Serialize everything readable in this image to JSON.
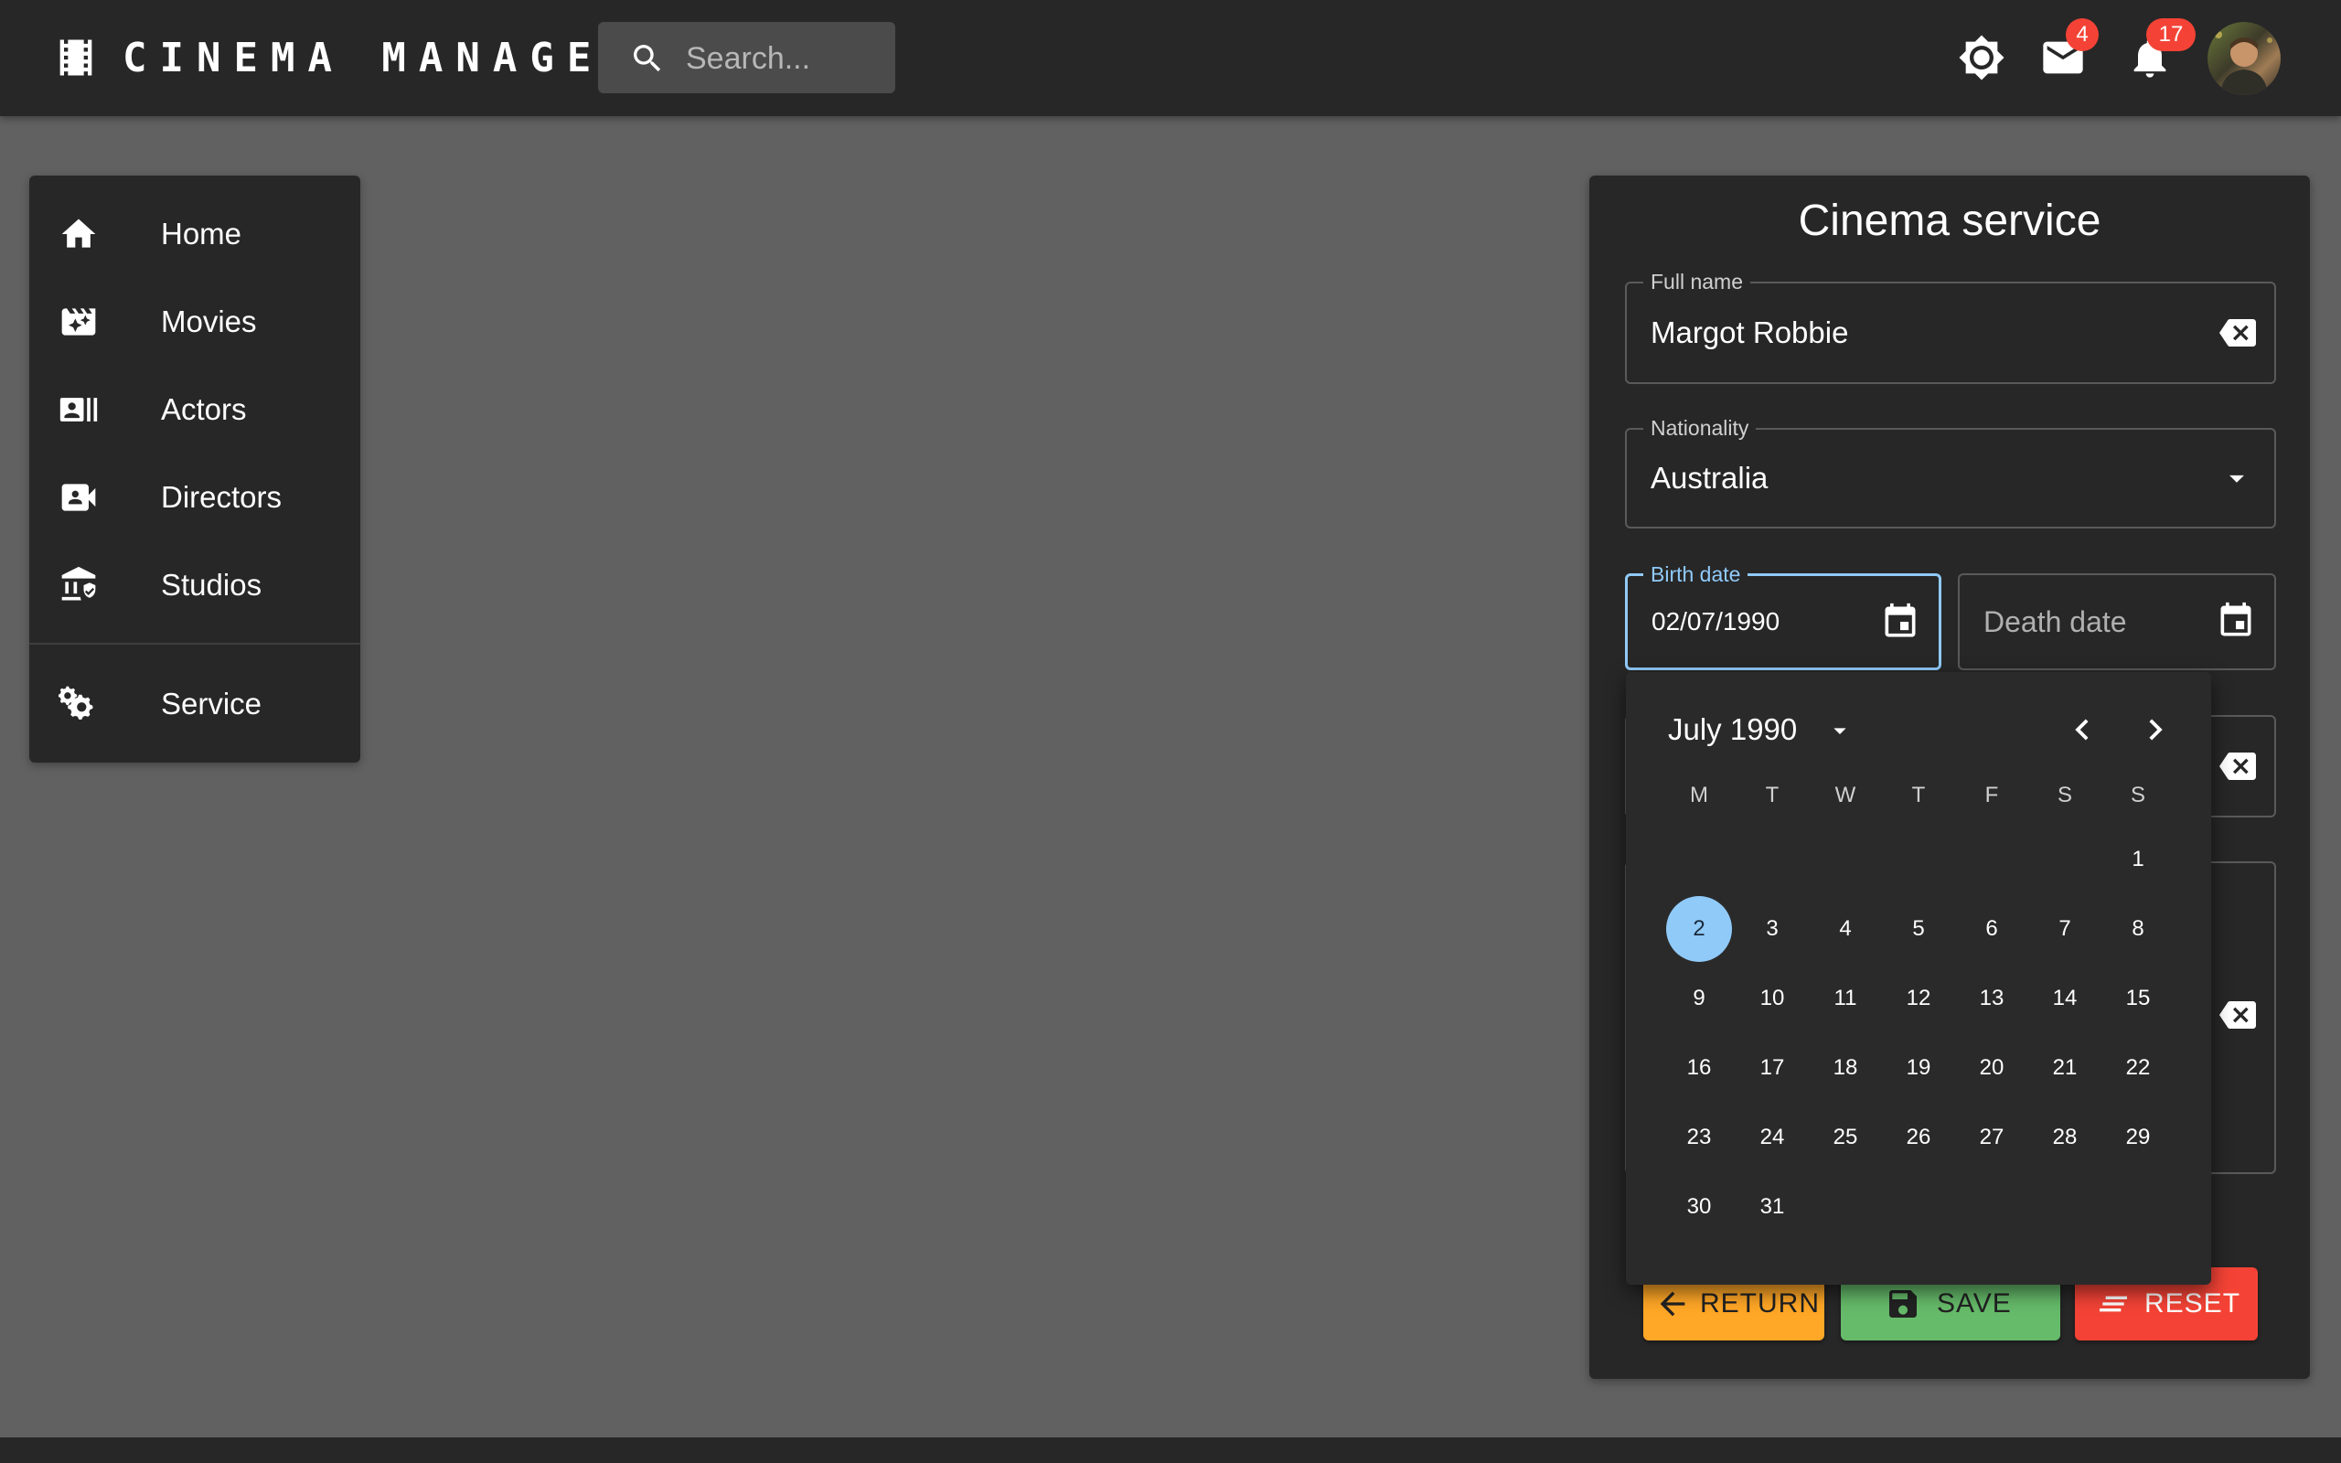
{
  "app": {
    "title": "CINEMA MANAGER"
  },
  "search": {
    "placeholder": "Search..."
  },
  "header": {
    "icons": [
      "brightness-icon",
      "mail-icon",
      "bell-icon"
    ],
    "mail_badge": "4",
    "notifications_badge": "17"
  },
  "sidebar": {
    "items": [
      {
        "label": "Home",
        "icon": "home-icon"
      },
      {
        "label": "Movies",
        "icon": "movie-filter-icon"
      },
      {
        "label": "Actors",
        "icon": "recent-actors-icon"
      },
      {
        "label": "Directors",
        "icon": "video-camera-front-icon"
      },
      {
        "label": "Studios",
        "icon": "studio-building-icon"
      },
      {
        "label": "Service",
        "icon": "settings-gears-icon"
      }
    ]
  },
  "form": {
    "title": "Cinema service",
    "full_name": {
      "label": "Full name",
      "value": "Margot Robbie"
    },
    "nationality": {
      "label": "Nationality",
      "value": "Australia"
    },
    "birth_date": {
      "label": "Birth date",
      "value": "02/07/1990"
    },
    "death_date": {
      "placeholder": "Death date"
    }
  },
  "calendar": {
    "month_label": "July 1990",
    "weekdays": [
      "M",
      "T",
      "W",
      "T",
      "F",
      "S",
      "S"
    ],
    "days": [
      "1",
      "2",
      "3",
      "4",
      "5",
      "6",
      "7",
      "8",
      "9",
      "10",
      "11",
      "12",
      "13",
      "14",
      "15",
      "16",
      "17",
      "18",
      "19",
      "20",
      "21",
      "22",
      "23",
      "24",
      "25",
      "26",
      "27",
      "28",
      "29",
      "30",
      "31"
    ],
    "selected_day": "2"
  },
  "buttons": {
    "return": "RETURN",
    "save": "SAVE",
    "reset": "RESET"
  },
  "colors": {
    "accent": "#90caf9",
    "return_button": "#ffa726",
    "save_button": "#66bb6a",
    "reset_button": "#f44336",
    "badge": "#f44336"
  }
}
